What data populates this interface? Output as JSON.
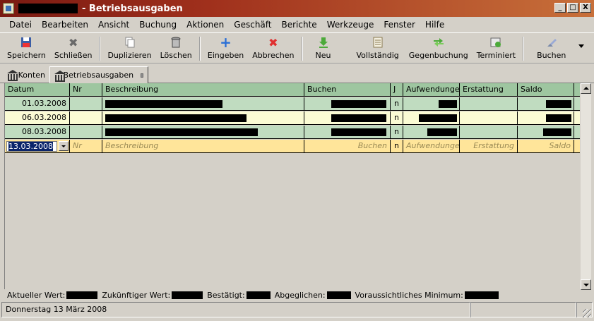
{
  "window": {
    "title": "- Betriebsausgaben",
    "buttons": {
      "minimize": "_",
      "maximize": "□",
      "close": "X"
    }
  },
  "menu": [
    {
      "label": "Datei"
    },
    {
      "label": "Bearbeiten"
    },
    {
      "label": "Ansicht"
    },
    {
      "label": "Buchung"
    },
    {
      "label": "Aktionen"
    },
    {
      "label": "Geschäft"
    },
    {
      "label": "Berichte"
    },
    {
      "label": "Werkzeuge"
    },
    {
      "label": "Fenster"
    },
    {
      "label": "Hilfe"
    }
  ],
  "toolbar": {
    "save": "Speichern",
    "close": "Schließen",
    "duplicate": "Duplizieren",
    "delete": "Löschen",
    "enter": "Eingeben",
    "cancel": "Abbrechen",
    "new": "Neu",
    "complete": "Vollständig",
    "counter": "Gegenbuchung",
    "scheduled": "Terminiert",
    "post": "Buchen"
  },
  "tabs": [
    {
      "label": "Konten"
    },
    {
      "label": "Betriebsausgaben"
    }
  ],
  "register": {
    "columns": [
      "Datum",
      "Nr",
      "Beschreibung",
      "Buchen",
      "J",
      "Aufwendungen",
      "Erstattung",
      "Saldo"
    ],
    "rows": [
      {
        "date": "01.03.2008",
        "reconcile": "n"
      },
      {
        "date": "06.03.2008",
        "reconcile": "n"
      },
      {
        "date": "08.03.2008",
        "reconcile": "n"
      }
    ],
    "entry": {
      "date": "13.03.2008",
      "num_placeholder": "Nr",
      "desc_placeholder": "Beschreibung",
      "transfer_placeholder": "Buchen",
      "reconcile": "n",
      "debit_placeholder": "Aufwendungen",
      "credit_placeholder": "Erstattung",
      "balance_placeholder": "Saldo"
    }
  },
  "summary": {
    "present": "Aktueller Wert:",
    "future": "Zukünftiger Wert:",
    "cleared": "Bestätigt:",
    "reconciled": "Abgeglichen:",
    "projected_min": "Voraussichtliches Minimum:"
  },
  "status": {
    "date_text": "Donnerstag 13 März 2008"
  }
}
